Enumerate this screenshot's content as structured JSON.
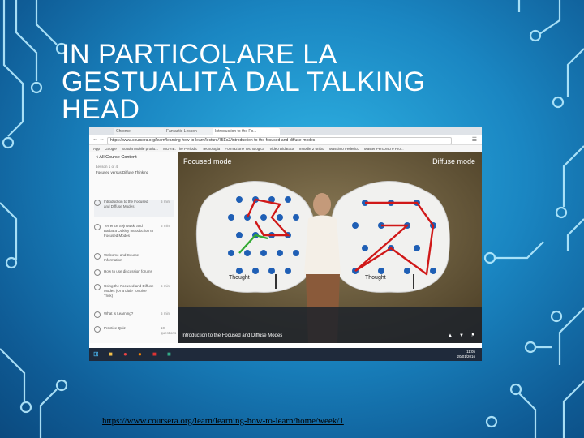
{
  "slide": {
    "title": "IN PARTICOLARE LA GESTUALITÀ DAL TALKING HEAD",
    "link": "https://www.coursera.org/learn/learning-how-to-learn/home/week/1"
  },
  "browser": {
    "tabs": [
      "Chrome",
      "Fantastic Lesson",
      "Introduction to the Fo..."
    ],
    "url": "https://www.coursera.org/learn/learning-how-to-learn/lecture/75EsZ/introduction-to-the-focused-and-diffuse-modes",
    "bookmarks": [
      "App",
      "Google",
      "Scuola Mobile produ...",
      "MOVIE: The Periodic",
      "Tecnologia",
      "Formazione Tecnologica",
      "Video Didattica",
      "moodle 2 unibo",
      "Massimo Federico",
      "Master Percorso e Pro..."
    ]
  },
  "sidebar": {
    "back_label": "< All Course Content",
    "lesson_label": "Lesson 1 of 4",
    "lesson_title": "Focused versus Diffuse Thinking",
    "items": [
      {
        "label": "Introduction to the Focused and Diffuse Modes",
        "duration": "5 min"
      },
      {
        "label": "Terrence Sejnowski and Barbara Oakley Introduction to Focused Modes",
        "duration": "5 min"
      },
      {
        "label": "Welcome and Course Information",
        "duration": ""
      },
      {
        "label": "How to use discussion forums",
        "duration": ""
      },
      {
        "label": "Using the Focused and Diffuse Modes (Or a Little Tortoise Trick)",
        "duration": "5 min"
      },
      {
        "label": "What is Learning?",
        "duration": "5 min"
      },
      {
        "label": "Practice Quiz",
        "duration": "10 questions"
      }
    ]
  },
  "video": {
    "focused_label": "Focused mode",
    "diffuse_label": "Diffuse mode",
    "thought_label": "Thought",
    "caption": "Introduction to the Focused and Diffuse Modes"
  },
  "taskbar": {
    "time": "11:05",
    "date": "20/01/2016"
  },
  "colors": {
    "accent": "#1a86c2",
    "circuit": "#b8ecff",
    "pinball_dot": "#1f5fb5",
    "focused_path": "#d01818"
  }
}
